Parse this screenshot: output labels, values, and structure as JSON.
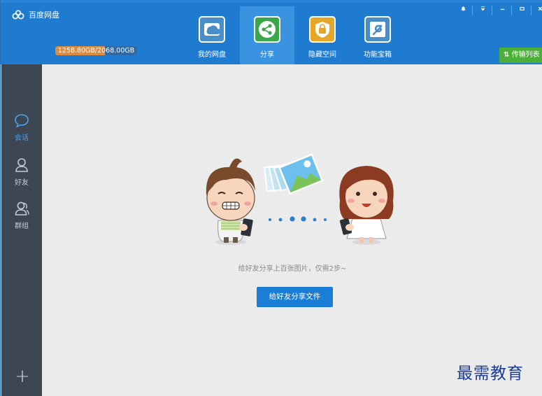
{
  "app": {
    "title": "百度网盘",
    "storage_text": "1258.80GB/2068.00GB",
    "storage_used_fraction": 0.609
  },
  "nav": [
    {
      "label": "我的网盘",
      "icon": "cloud-drive-icon",
      "color": "#4a8ec9",
      "active": false
    },
    {
      "label": "分享",
      "icon": "share-icon",
      "color": "#3aa84a",
      "active": true
    },
    {
      "label": "隐藏空间",
      "icon": "lock-icon",
      "color": "#e6a628",
      "active": false
    },
    {
      "label": "功能宝箱",
      "icon": "wrench-icon",
      "color": "#4a8ec9",
      "active": false
    }
  ],
  "window_controls": [
    "bell-icon",
    "menu-icon",
    "minimize-icon",
    "maximize-icon",
    "close-icon"
  ],
  "transfer": {
    "label": "传输列表",
    "icon": "transfer-arrows-icon"
  },
  "sidebar": {
    "items": [
      {
        "label": "会话",
        "icon": "chat-bubble-icon",
        "active": true
      },
      {
        "label": "好友",
        "icon": "person-icon",
        "active": false
      },
      {
        "label": "群组",
        "icon": "group-icon",
        "active": false
      }
    ],
    "add_icon": "plus-icon"
  },
  "main": {
    "hint": "给好友分享上百张图片，仅需2步~",
    "button_label": "给好友分享文件"
  },
  "watermark": "最需教育",
  "colors": {
    "header": "#1f7bd0",
    "active_nav": "#3a93e0",
    "sidebar": "#3d4653",
    "accent": "#1a7ed6",
    "transfer": "#4caf3a"
  }
}
